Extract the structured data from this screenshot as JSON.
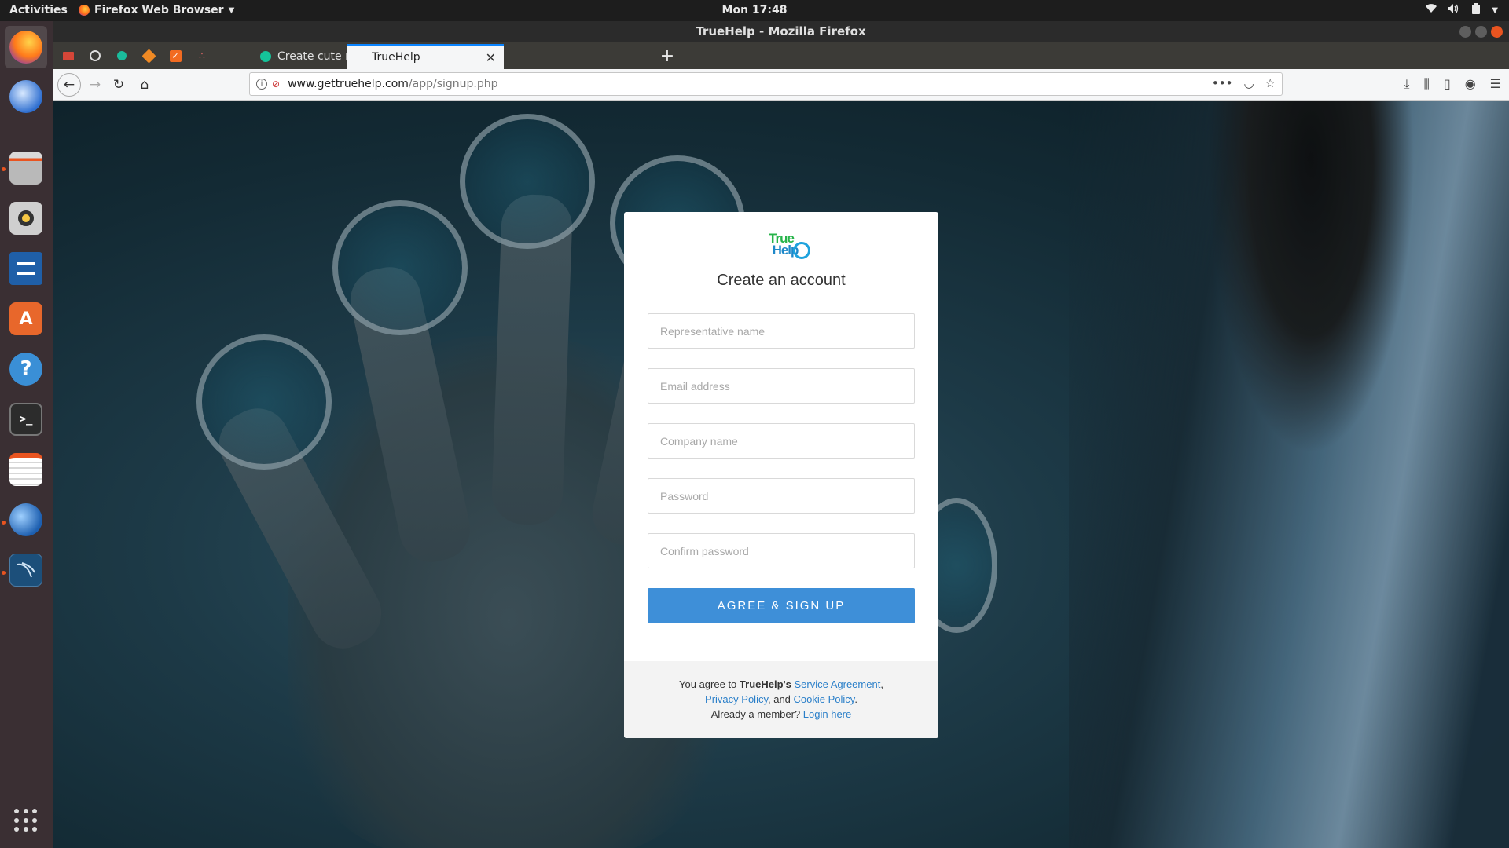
{
  "system": {
    "activities": "Activities",
    "app_menu": "Firefox Web Browser",
    "clock": "Mon 17:48"
  },
  "dock": {
    "items": [
      "firefox-icon",
      "thunderbird-icon",
      "files-icon",
      "rhythmbox-icon",
      "writer-icon",
      "software-center-icon",
      "help-icon",
      "terminal-icon",
      "text-editor-icon",
      "mail-client-icon",
      "mysql-workbench-icon"
    ],
    "show_apps": "show-applications-icon"
  },
  "browser": {
    "window_title": "TrueHelp - Mozilla Firefox",
    "tabs": [
      {
        "label": "Create cute nursery rhym",
        "active": false
      },
      {
        "label": "TrueHelp",
        "active": true
      }
    ],
    "url_domain": "www.gettruehelp.com",
    "url_path": "/app/signup.php"
  },
  "signup": {
    "logo_line1": "True",
    "logo_line2": "Help",
    "title": "Create an account",
    "fields": {
      "rep_name": "Representative name",
      "email": "Email address",
      "company": "Company name",
      "password": "Password",
      "confirm_password": "Confirm password"
    },
    "button": "AGREE & SIGN UP",
    "footer": {
      "agree_prefix": "You agree to ",
      "brand": "TrueHelp's",
      "service_agreement": "Service Agreement",
      "comma": ",",
      "privacy": "Privacy Policy",
      "and": ", and ",
      "cookie": "Cookie Policy",
      "period": ".",
      "member": "Already a member? ",
      "login": "Login here"
    }
  },
  "colors": {
    "accent": "#3e8fd8",
    "link": "#2a7fc9",
    "dock_bg": "#3a2f33",
    "ubuntu_orange": "#e95420"
  }
}
